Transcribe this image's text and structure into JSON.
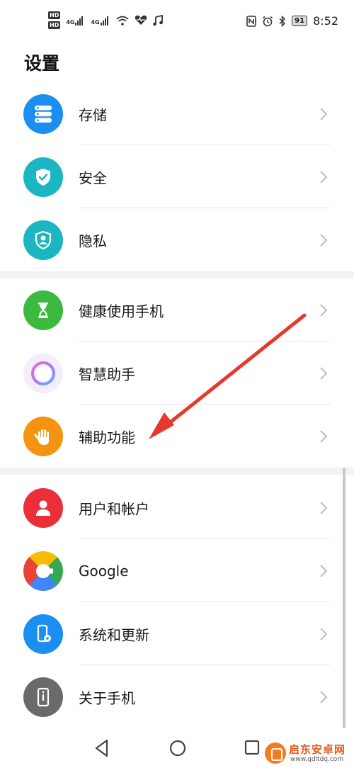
{
  "status_bar": {
    "left_badges": [
      "HD",
      "HD"
    ],
    "network": [
      "4G",
      "4G"
    ],
    "battery": "91",
    "time": "8:52"
  },
  "page": {
    "title": "设置"
  },
  "groups": [
    {
      "items": [
        {
          "label": "存储",
          "icon": "storage-icon",
          "color": "#1a8ff0"
        },
        {
          "label": "安全",
          "icon": "shield-check-icon",
          "color": "#1bb6c1"
        },
        {
          "label": "隐私",
          "icon": "privacy-person-icon",
          "color": "#1bb6c1"
        }
      ]
    },
    {
      "items": [
        {
          "label": "健康使用手机",
          "icon": "hourglass-icon",
          "color": "#3cba3f"
        },
        {
          "label": "智慧助手",
          "icon": "assistant-ring-icon",
          "color": "#b28cf5"
        },
        {
          "label": "辅助功能",
          "icon": "hand-icon",
          "color": "#f5940f"
        }
      ]
    },
    {
      "items": [
        {
          "label": "用户和帐户",
          "icon": "user-icon",
          "color": "#ea2e3a"
        },
        {
          "label": "Google",
          "icon": "google-icon",
          "color": "#4285f4"
        },
        {
          "label": "系统和更新",
          "icon": "phone-gear-icon",
          "color": "#1a8ff0"
        },
        {
          "label": "关于手机",
          "icon": "phone-info-icon",
          "color": "#6a6a6a"
        }
      ]
    }
  ],
  "watermark": {
    "text": "启东安卓网",
    "url": "www.qdltdq.com"
  },
  "colors": {
    "annotation_arrow": "#e8372d",
    "chevron": "#bdbdbd",
    "divider": "#e6e6e6"
  }
}
